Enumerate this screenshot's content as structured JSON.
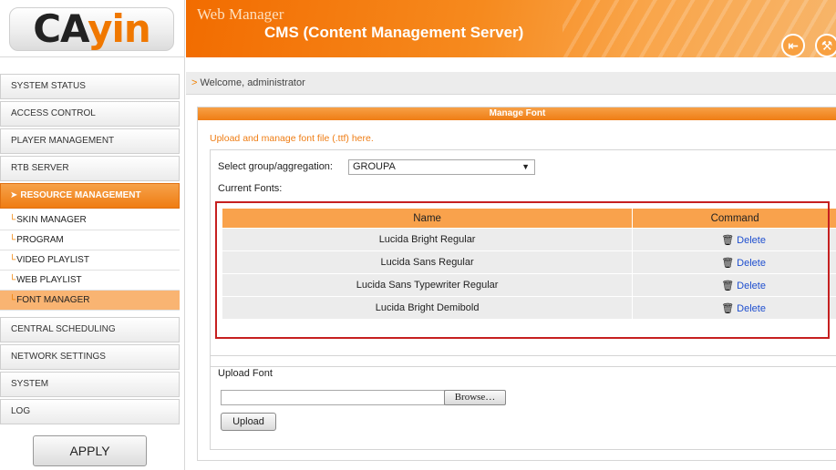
{
  "brand": {
    "logo_ca": "CA",
    "logo_yin": "yin",
    "colors": {
      "accent": "#ef7d14",
      "accent_light": "#f9a24c",
      "link": "#1f4fcf",
      "highlight": "#c62020"
    }
  },
  "header": {
    "title": "Web Manager",
    "subtitle": "CMS (Content Management Server)",
    "logout_icon": "logout-icon",
    "tools_icon": "wrench-icon"
  },
  "sidebar": {
    "items": [
      {
        "label": "SYSTEM STATUS"
      },
      {
        "label": "ACCESS CONTROL"
      },
      {
        "label": "PLAYER MANAGEMENT"
      },
      {
        "label": "RTB SERVER"
      },
      {
        "label": "RESOURCE MANAGEMENT"
      },
      {
        "label": "CENTRAL SCHEDULING"
      },
      {
        "label": "NETWORK SETTINGS"
      },
      {
        "label": "SYSTEM"
      },
      {
        "label": "LOG"
      }
    ],
    "subitems": [
      {
        "label": "SKIN MANAGER"
      },
      {
        "label": "PROGRAM"
      },
      {
        "label": "VIDEO PLAYLIST"
      },
      {
        "label": "WEB PLAYLIST"
      },
      {
        "label": "FONT MANAGER"
      }
    ],
    "apply_label": "APPLY"
  },
  "welcome": "Welcome, administrator",
  "panel": {
    "title": "Manage Font",
    "intro": "Upload and manage font file (.ttf) here.",
    "group_label": "Select group/aggregation:",
    "group_value": "GROUPA",
    "current_fonts_label": "Current Fonts:",
    "table": {
      "columns": [
        "Name",
        "Command"
      ],
      "delete_label": "Delete",
      "rows": [
        {
          "name": "Lucida Bright Regular"
        },
        {
          "name": "Lucida Sans Regular"
        },
        {
          "name": "Lucida Sans Typewriter Regular"
        },
        {
          "name": "Lucida Bright Demibold"
        }
      ]
    },
    "upload": {
      "title": "Upload Font",
      "browse_label": "Browse…",
      "upload_label": "Upload"
    }
  }
}
